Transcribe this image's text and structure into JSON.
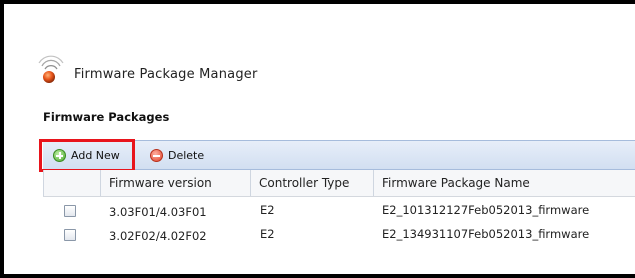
{
  "app": {
    "title": "Firmware Package Manager"
  },
  "section": {
    "title": "Firmware Packages"
  },
  "toolbar": {
    "add_label": "Add New",
    "delete_label": "Delete"
  },
  "grid": {
    "columns": [
      "",
      "Firmware version",
      "Controller Type",
      "Firmware Package Name"
    ],
    "rows": [
      {
        "version": "3.03F01/4.03F01",
        "controller": "E2",
        "package": "E2_101312127Feb052013_firmware"
      },
      {
        "version": "3.02F02/4.02F02",
        "controller": "E2",
        "package": "E2_134931107Feb052013_firmware"
      }
    ]
  },
  "colors": {
    "highlight": "#e8141c",
    "toolbar": "#d2dff1"
  }
}
